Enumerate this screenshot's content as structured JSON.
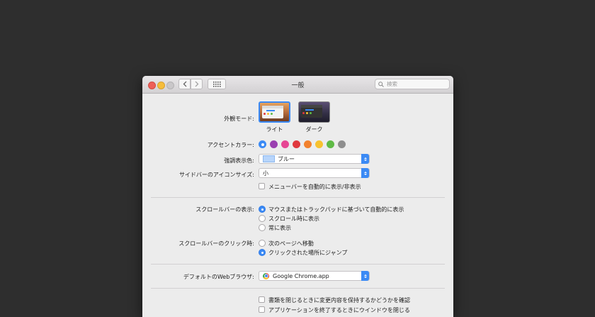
{
  "window": {
    "title": "一般",
    "search_placeholder": "検索"
  },
  "appearance": {
    "label": "外観モード:",
    "options": [
      {
        "label": "ライト",
        "selected": true
      },
      {
        "label": "ダーク",
        "selected": false
      }
    ]
  },
  "accent": {
    "label": "アクセントカラー:",
    "colors": [
      "#3b8af5",
      "#9a3fb0",
      "#e64694",
      "#e0383e",
      "#f2812d",
      "#f7c22f",
      "#5fba46",
      "#8e8e8e"
    ],
    "selected_index": 0
  },
  "highlight": {
    "label": "強調表示色:",
    "value": "ブルー"
  },
  "sidebar_icon_size": {
    "label": "サイドバーのアイコンサイズ:",
    "value": "小"
  },
  "menubar": {
    "label": "メニューバーを自動的に表示/非表示",
    "checked": false
  },
  "show_scrollbars": {
    "label": "スクロールバーの表示:",
    "options": [
      {
        "label": "マウスまたはトラックパッドに基づいて自動的に表示",
        "selected": true
      },
      {
        "label": "スクロール時に表示",
        "selected": false
      },
      {
        "label": "常に表示",
        "selected": false
      }
    ]
  },
  "click_scrollbar": {
    "label": "スクロールバーのクリック時:",
    "options": [
      {
        "label": "次のページへ移動",
        "selected": false
      },
      {
        "label": "クリックされた場所にジャンプ",
        "selected": true
      }
    ]
  },
  "browser": {
    "label": "デフォルトのWebブラウザ:",
    "value": "Google Chrome.app"
  },
  "documents": {
    "ask_keep_changes": "書類を閉じるときに変更内容を保持するかどうかを確認",
    "close_windows": "アプリケーションを終了するときにウインドウを閉じる"
  }
}
